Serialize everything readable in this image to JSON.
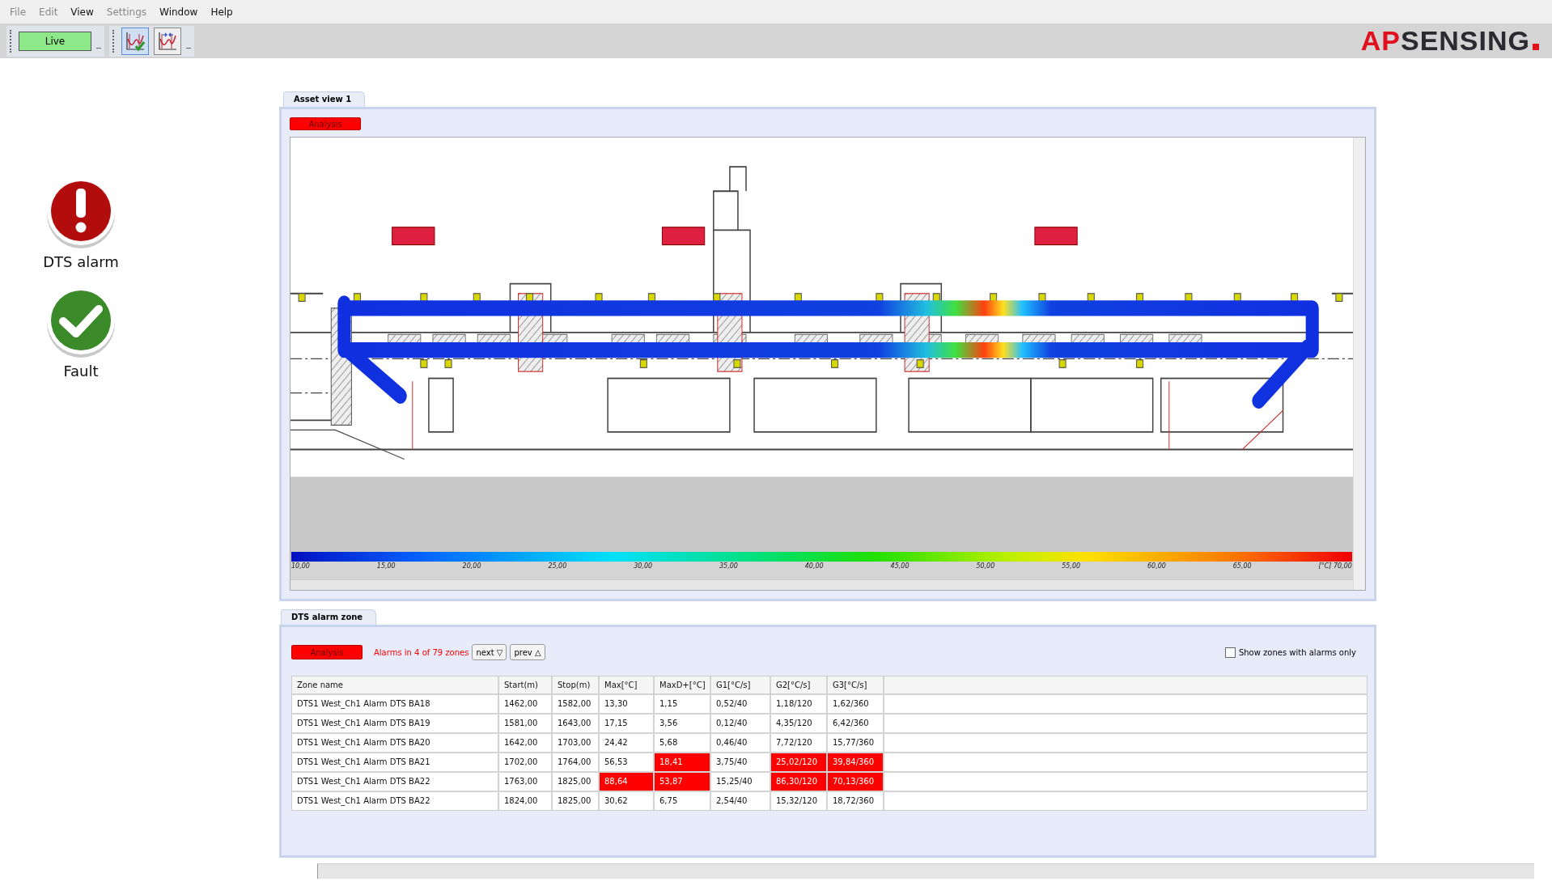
{
  "menu": [
    {
      "label": "File",
      "disabled": true
    },
    {
      "label": "Edit",
      "disabled": true
    },
    {
      "label": "View",
      "disabled": false
    },
    {
      "label": "Settings",
      "disabled": true
    },
    {
      "label": "Window",
      "disabled": false
    },
    {
      "label": "Help",
      "disabled": false
    }
  ],
  "toolbar": {
    "live_button": "Live",
    "tools": [
      {
        "kind": "trace-check",
        "selected": true
      },
      {
        "kind": "trace-markers",
        "selected": false
      }
    ]
  },
  "logo": {
    "part_1": "AP",
    "part_2": "SENSING"
  },
  "indicators": [
    {
      "kind": "alarm",
      "label": "DTS alarm"
    },
    {
      "kind": "ok",
      "label": "Fault"
    }
  ],
  "asset_view": {
    "tab": "Asset view 1",
    "status_button": "Analysis",
    "colorbar_ticks": [
      "10,00",
      "15,00",
      "20,00",
      "25,00",
      "30,00",
      "35,00",
      "40,00",
      "45,00",
      "50,00",
      "55,00",
      "60,00",
      "65,00",
      "[°C] 70,00"
    ]
  },
  "alarm_zone": {
    "tab": "DTS alarm zone",
    "status_button": "Analysis",
    "summary": "Alarms in 4 of 79 zones",
    "next_button": "next ▽",
    "prev_button": "prev △",
    "show_alarms_only": {
      "label": "Show zones with alarms only",
      "checked": false
    },
    "table": {
      "columns": [
        "Zone name",
        "Start(m)",
        "Stop(m)",
        "Max[°C]",
        "MaxD+[°C]",
        "G1[°C/s]",
        "G2[°C/s]",
        "G3[°C/s]"
      ],
      "rows": [
        [
          {
            "text": "DTS1 West_Ch1 Alarm DTS BA18",
            "alarm": false
          },
          {
            "text": "1462,00",
            "alarm": false
          },
          {
            "text": "1582,00",
            "alarm": false
          },
          {
            "text": "13,30",
            "alarm": false
          },
          {
            "text": "1,15",
            "alarm": false
          },
          {
            "text": "0,52/40",
            "alarm": false
          },
          {
            "text": "1,18/120",
            "alarm": false
          },
          {
            "text": "1,62/360",
            "alarm": false
          }
        ],
        [
          {
            "text": "DTS1 West_Ch1 Alarm DTS BA19",
            "alarm": false
          },
          {
            "text": "1581,00",
            "alarm": false
          },
          {
            "text": "1643,00",
            "alarm": false
          },
          {
            "text": "17,15",
            "alarm": false
          },
          {
            "text": "3,56",
            "alarm": false
          },
          {
            "text": "0,12/40",
            "alarm": false
          },
          {
            "text": "4,35/120",
            "alarm": false
          },
          {
            "text": "6,42/360",
            "alarm": false
          }
        ],
        [
          {
            "text": "DTS1 West_Ch1 Alarm DTS BA20",
            "alarm": false
          },
          {
            "text": "1642,00",
            "alarm": false
          },
          {
            "text": "1703,00",
            "alarm": false
          },
          {
            "text": "24,42",
            "alarm": false
          },
          {
            "text": "5,68",
            "alarm": false
          },
          {
            "text": "0,46/40",
            "alarm": false
          },
          {
            "text": "7,72/120",
            "alarm": false
          },
          {
            "text": "15,77/360",
            "alarm": false
          }
        ],
        [
          {
            "text": "DTS1 West_Ch1 Alarm DTS BA21",
            "alarm": false
          },
          {
            "text": "1702,00",
            "alarm": false
          },
          {
            "text": "1764,00",
            "alarm": false
          },
          {
            "text": "56,53",
            "alarm": false
          },
          {
            "text": "18,41",
            "alarm": true
          },
          {
            "text": "3,75/40",
            "alarm": false
          },
          {
            "text": "25,02/120",
            "alarm": true
          },
          {
            "text": "39,84/360",
            "alarm": true
          }
        ],
        [
          {
            "text": "DTS1 West_Ch1 Alarm DTS BA22",
            "alarm": false
          },
          {
            "text": "1763,00",
            "alarm": false
          },
          {
            "text": "1825,00",
            "alarm": false
          },
          {
            "text": "88,64",
            "alarm": true
          },
          {
            "text": "53,87",
            "alarm": true
          },
          {
            "text": "15,25/40",
            "alarm": false
          },
          {
            "text": "86,30/120",
            "alarm": true
          },
          {
            "text": "70,13/360",
            "alarm": true
          }
        ],
        [
          {
            "text": "DTS1 West_Ch1 Alarm DTS BA22",
            "alarm": false
          },
          {
            "text": "1824,00",
            "alarm": false
          },
          {
            "text": "1825,00",
            "alarm": false
          },
          {
            "text": "30,62",
            "alarm": false
          },
          {
            "text": "6,75",
            "alarm": false
          },
          {
            "text": "2,54/40",
            "alarm": false
          },
          {
            "text": "15,32/120",
            "alarm": false
          },
          {
            "text": "18,72/360",
            "alarm": false
          }
        ]
      ]
    }
  }
}
